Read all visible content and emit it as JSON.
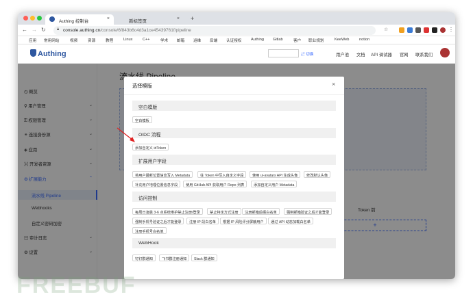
{
  "browser": {
    "tabs": [
      {
        "label": "Authing 控制台",
        "active": true
      },
      {
        "label": "新标签页",
        "active": false
      }
    ],
    "close_glyph": "×",
    "new_tab_glyph": "+",
    "url_host": "console.authing.cn",
    "url_path": "/console/6f843b6c4d3a1ce45439761f/pipeline",
    "bookmarks": [
      "应用",
      "常用网站",
      "视频",
      "资源",
      "教程",
      "Linux",
      "C++",
      "学术",
      "邮箱",
      "运维",
      "后端",
      "认证授权",
      "Authing",
      "Gitlab",
      "客户",
      "职业规划",
      "KeeWeb",
      "notion"
    ]
  },
  "app": {
    "logo": "Authing",
    "header_nav": [
      "用户池",
      "文档",
      "API 调试器",
      "官网",
      "联系我们"
    ],
    "search_link": "⇄ 切换"
  },
  "sidebar": {
    "items": [
      {
        "label": "概览",
        "chevron": false
      },
      {
        "label": "用户管理",
        "chevron": true
      },
      {
        "label": "权限管理",
        "chevron": true
      },
      {
        "label": "连接身份源",
        "chevron": true
      },
      {
        "label": "应用",
        "chevron": true
      },
      {
        "label": "开发者资源",
        "chevron": true
      },
      {
        "label": "扩展能力",
        "chevron": true
      },
      {
        "label": "审计日志",
        "chevron": true
      },
      {
        "label": "设置",
        "chevron": true
      }
    ],
    "subitems": [
      "流水线 Pipeline",
      "Webhooks",
      "自定义密码加密"
    ]
  },
  "page": {
    "title": "流水线 Pipeline",
    "partial_text": "Token 前",
    "add_button": "+"
  },
  "modal": {
    "title": "选择模版",
    "close": "×",
    "sections": [
      {
        "title": "空白模版",
        "chips": [
          "空白模板"
        ]
      },
      {
        "title": "OIDC 流程",
        "chips": [
          "添加自定义 idToken"
        ]
      },
      {
        "title": "扩展用户字段",
        "chips": [
          "将用户最新位置信息写入 Metadata",
          "往 Token 中写入自定义字段",
          "使用 ui-avatars API 生成头像",
          "修改默认头像",
          "补充用户地理位置信息字段",
          "使用 GitHub API 获取用户 Repo 列表",
          "添加自定义用户 Metadata"
        ]
      },
      {
        "title": "访问控制",
        "chips": [
          "每周日凌晨 3-6 点系统维护禁止注册/登录",
          "禁止特定方式注册",
          "注册邮箱后缀白名单",
          "强制邮箱验证之后才能登录",
          "强制手机号验证之后才能登录",
          "注册 IP 段白名单",
          "根据 IP 风险评分屏蔽用户",
          "通过 API 动态加载白名单",
          "注册手机号白名单"
        ]
      },
      {
        "title": "WebHook",
        "chips": [
          "钉钉群通知",
          "飞书群注册通知",
          "Slack 群通知"
        ]
      }
    ]
  },
  "watermark": "FREEBUF",
  "colors": {
    "accent": "#396aff",
    "arrow": "#e02020",
    "brand": "#2e57a0"
  }
}
